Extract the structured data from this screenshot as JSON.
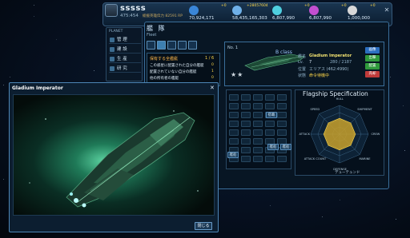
{
  "header": {
    "username": "sssss",
    "coords": "475:454",
    "rank_text": "総援英雄伝力 82591 RP",
    "close_glyph": "✕"
  },
  "resources": [
    {
      "name": "credits",
      "icon": "credit-icon",
      "color": "#3a86d8",
      "plus": "+0",
      "value": "70,924,171"
    },
    {
      "name": "metal",
      "icon": "metal-icon",
      "color": "#6fb0e8",
      "plus": "+28057604",
      "value": "58,435,165,303"
    },
    {
      "name": "crystal",
      "icon": "crystal-icon",
      "color": "#4fd0e0",
      "plus": "+0",
      "value": "6,807,990"
    },
    {
      "name": "gas",
      "icon": "gas-icon",
      "color": "#c44fd0",
      "plus": "+0",
      "value": "6,807,990"
    },
    {
      "name": "population",
      "icon": "person-icon",
      "color": "#d8d8d8",
      "plus": "+0",
      "value": "1,000,000"
    }
  ],
  "sidebar": {
    "heading": "PLANET",
    "items": [
      {
        "label": "管 理"
      },
      {
        "label": "建 設"
      },
      {
        "label": "生 産"
      },
      {
        "label": "研 究"
      }
    ]
  },
  "fleet": {
    "title": "艦 隊",
    "subtitle": "Fleet",
    "info_title": "保有する全艦艇",
    "info_count": "1 / 6",
    "rows": [
      {
        "label": "この惑星に配置された自分の艦艇",
        "value": "0"
      },
      {
        "label": "配置されていない自分の艦艇",
        "value": "1"
      },
      {
        "label": "他の所有者の艦艇",
        "value": "0"
      }
    ]
  },
  "ship": {
    "number": "No. 1",
    "class": "B class",
    "stars": "★★",
    "name_label": "艦名",
    "name": "Gladium Imperator",
    "level_label": "Lv.",
    "level": "7",
    "exp": "280 / 2187",
    "position_label": "位置",
    "position": "エリアス (462:4990)",
    "status_label": "状態",
    "status": "命令待機中",
    "buttons": [
      {
        "label": "画像",
        "color": "#2c6fc0"
      },
      {
        "label": "出撃",
        "color": "#2f9a3c"
      },
      {
        "label": "配置",
        "color": "#2f9a3c"
      },
      {
        "label": "売却",
        "color": "#c03a3a"
      }
    ]
  },
  "grid": {
    "buttons": [
      {
        "label": "搭載"
      },
      {
        "label": "艦船"
      },
      {
        "label": "艦船"
      },
      {
        "label": "艦船"
      }
    ]
  },
  "spec": {
    "title": "Flagship Specification",
    "axes": [
      "HULL",
      "SHIPMENT",
      "CREW",
      "MARINE",
      "DEFENSE",
      "ATTACK COUNT",
      "ATTACK",
      "SPEED"
    ],
    "values": [
      0.55,
      0.55,
      0.55,
      0.55,
      0.55,
      0.55,
      0.55,
      0.55
    ],
    "footer": "デューテュンド"
  },
  "viewer": {
    "title": "Gladium Imperator",
    "close_glyph": "✕",
    "close_button": "閉じる"
  },
  "colors": {
    "accent": "#3a6e9a",
    "highlight": "#ffd84a",
    "spec_fill": "#c8a02c"
  }
}
